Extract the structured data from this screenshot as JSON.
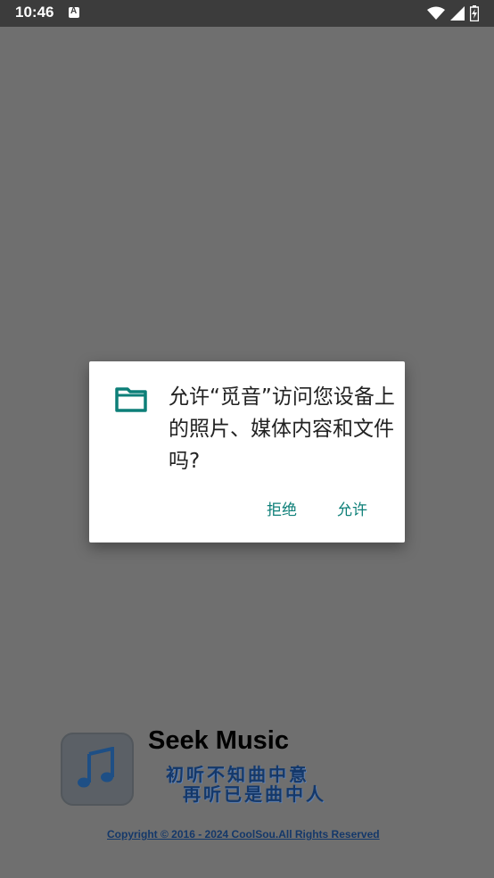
{
  "status_bar": {
    "time": "10:46",
    "icons": [
      "notification-a-icon",
      "wifi-icon",
      "signal-icon",
      "battery-icon"
    ]
  },
  "dialog": {
    "message": "允许“觅音”访问您设备上的照片、媒体内容和文件吗?",
    "icon": "folder-icon",
    "deny_label": "拒绝",
    "allow_label": "允许",
    "accent_color": "#0d7f78"
  },
  "splash": {
    "app_name": "Seek Music",
    "slogan_line1": "初听不知曲中意",
    "slogan_line2": "再听已是曲中人",
    "copyright": "Copyright © 2016 - 2024 CoolSou.All Rights Reserved",
    "icon": "music-note-icon"
  }
}
